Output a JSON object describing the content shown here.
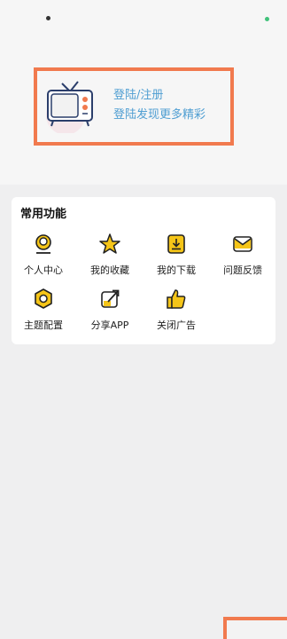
{
  "login": {
    "title": "登陆/注册",
    "subtitle": "登陆发现更多精彩",
    "tv_icon": "retro-tv-icon"
  },
  "features": {
    "title": "常用功能",
    "items": [
      {
        "label": "个人中心",
        "icon": "user-center-icon"
      },
      {
        "label": "我的收藏",
        "icon": "star-icon"
      },
      {
        "label": "我的下载",
        "icon": "download-icon"
      },
      {
        "label": "问题反馈",
        "icon": "feedback-mail-icon"
      },
      {
        "label": "主题配置",
        "icon": "theme-gear-icon"
      },
      {
        "label": "分享APP",
        "icon": "share-icon"
      },
      {
        "label": "关闭广告",
        "icon": "thumbs-up-icon"
      }
    ]
  },
  "colors": {
    "accent": "#f17a4e",
    "link": "#4f9ed2",
    "icon_yellow": "#f5c518"
  }
}
